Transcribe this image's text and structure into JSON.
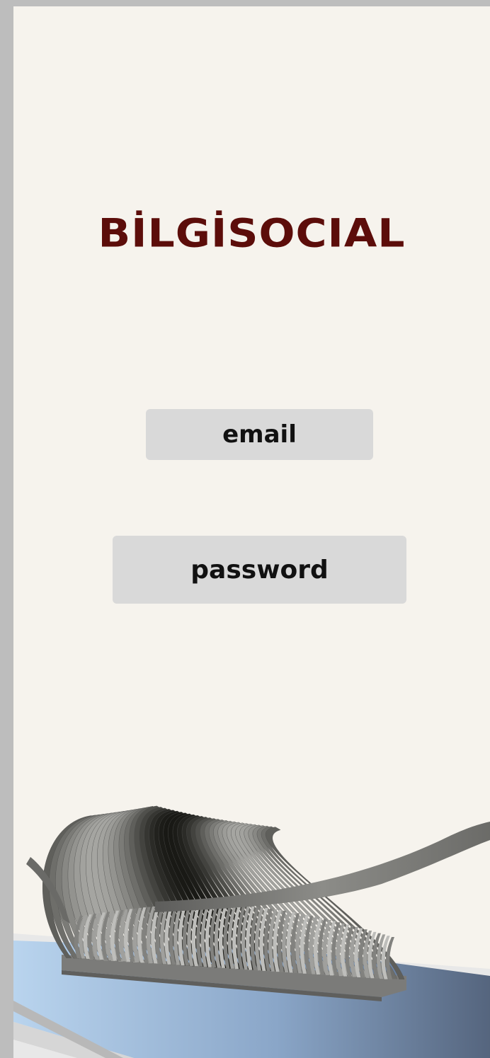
{
  "app": {
    "brand_title": "BİLGİSOCIAL"
  },
  "login_form": {
    "email_placeholder": "email",
    "password_placeholder": "password"
  },
  "illustration": {
    "name": "parametric-ribbon-sculpture",
    "colors": {
      "background": "#f6f3ed",
      "brand": "#5c0d0a",
      "field": "#d9d9d9",
      "water_light": "#b9d4ee",
      "water_dark": "#55657e",
      "ribbon": "#8a8a86"
    }
  }
}
